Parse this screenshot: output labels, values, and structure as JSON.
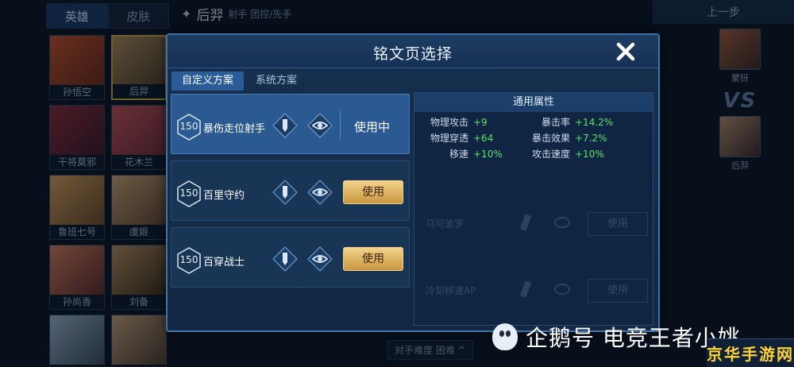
{
  "background": {
    "tabs": [
      "英雄",
      "皮肤"
    ],
    "heroes": [
      "孙悟空",
      "后羿",
      "干将莫邪",
      "花木兰",
      "鲁班七号",
      "虞姬",
      "孙尚香",
      "刘备",
      "",
      ""
    ],
    "selected_hero": "后羿",
    "current_hero_name": "后羿",
    "current_hero_role": "射手 团控/先手",
    "top_right_button": "上一步",
    "team": [
      "蒙犽",
      "后羿"
    ],
    "vs_text": "VS",
    "difficulty": "对手难度 困难 ^"
  },
  "modal": {
    "title": "铭文页选择",
    "close_label": "close",
    "tabs": [
      {
        "label": "自定义方案",
        "active": true
      },
      {
        "label": "系统方案",
        "active": false
      }
    ],
    "plans": [
      {
        "level": "150",
        "name": "暴伤走位射手",
        "action": "使用中",
        "in_use": true
      },
      {
        "level": "150",
        "name": "百里守约",
        "action": "使用",
        "in_use": false
      },
      {
        "level": "150",
        "name": "百穿战士",
        "action": "使用",
        "in_use": false
      }
    ],
    "stats": {
      "header": "通用属性",
      "rows": [
        {
          "l1": "物理攻击",
          "v1": "+9",
          "l2": "暴击率",
          "v2": "+14.2%"
        },
        {
          "l1": "物理穿透",
          "v1": "+64",
          "l2": "暴击效果",
          "v2": "+7.2%"
        },
        {
          "l1": "移速",
          "v1": "+10%",
          "l2": "攻击速度",
          "v2": "+10%"
        }
      ]
    },
    "faded_plans": [
      {
        "name": "马可波罗",
        "action": "使用"
      },
      {
        "name": "冷却移速AP",
        "action": "使用"
      }
    ]
  },
  "watermark": "企鹅号 电竞王者小姚",
  "corner_logo": "京华手游网",
  "colors": {
    "accent_blue": "#2b5a92",
    "gold_button": "#d9ac5a",
    "stat_green": "#5ee06c"
  }
}
